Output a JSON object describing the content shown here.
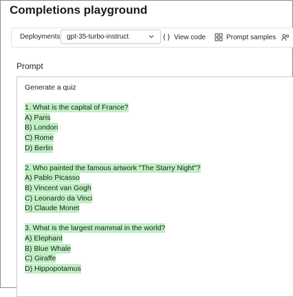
{
  "header": {
    "title": "Completions playground"
  },
  "toolbar": {
    "deployments_label": "Deployments",
    "deployment_value": "gpt-35-turbo-instruct",
    "view_code_label": "View code",
    "prompt_samples_label": "Prompt samples",
    "extra_icon": "people-icon"
  },
  "prompt": {
    "label": "Prompt",
    "intro": "Generate a quiz",
    "questions": [
      {
        "question": "1. What is the capital of France?",
        "options": [
          "A) Paris",
          "B) London",
          "C) Rome",
          "D) Berlin"
        ]
      },
      {
        "question": "2. Who painted the famous artwork \"The Starry Night\"?",
        "options": [
          "A) Pablo Picasso",
          "B) Vincent van Gogh",
          "C) Leonardo da Vinci",
          "D) Claude Monet"
        ]
      },
      {
        "question": "3. What is the largest mammal in the world?",
        "options": [
          "A) Elephant",
          "B) Blue Whale",
          "C) Giraffe",
          "D) Hippopotamus"
        ]
      }
    ],
    "highlight_color": "#bff0c3"
  }
}
